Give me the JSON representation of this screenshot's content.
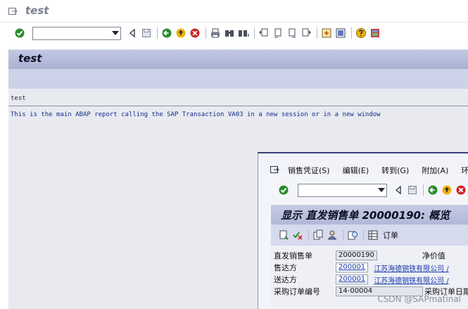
{
  "app": {
    "title": "test"
  },
  "main": {
    "screen_title": "test",
    "list_header": "test",
    "list_text": "This is the main ABAP report calling the SAP Transaction VA03 in a new session or in a new window",
    "command_field": {
      "value": ""
    }
  },
  "popup": {
    "menu": [
      {
        "label": "销售凭证(S)"
      },
      {
        "label": "编辑(E)"
      },
      {
        "label": "转到(G)"
      },
      {
        "label": "附加(A)"
      },
      {
        "label": "环"
      }
    ],
    "command_field": {
      "value": ""
    },
    "screen_title": "显示 直发销售单 20000190: 概览",
    "app_button_label": "订单",
    "fields": {
      "order": {
        "label": "直发销售单",
        "value": "20000190",
        "right_label": "净价值"
      },
      "sold_to": {
        "label": "售达方",
        "value": "200001",
        "description": "江苏海德钢铁有限公司 /"
      },
      "ship_to": {
        "label": "送达方",
        "value": "200001",
        "description": "江苏海德钢铁有限公司 /"
      },
      "po": {
        "label": "采购订单编号",
        "value": "14-00004",
        "right_label": "采购订单日期"
      }
    }
  },
  "watermark": "CSDN @SAPmatinal",
  "colors": {
    "title_bar": "#b1b8d8",
    "content_bg": "#e8eaf0",
    "list_text": "#102a8a",
    "link": "#1a3aa8"
  }
}
